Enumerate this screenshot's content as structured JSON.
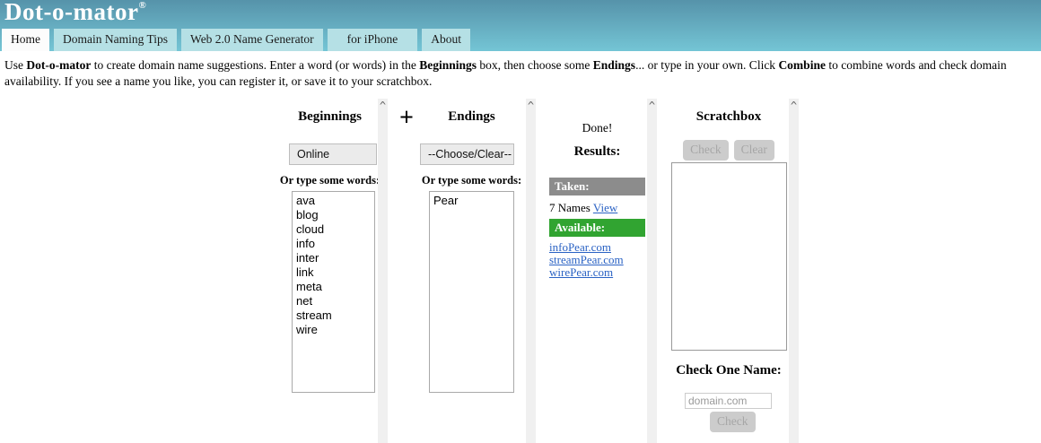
{
  "header": {
    "title": "Dot-o-mator",
    "registered_mark": "®",
    "tabs": [
      {
        "label": "Home",
        "active": true
      },
      {
        "label": "Domain Naming Tips",
        "active": false
      },
      {
        "label": "Web 2.0 Name Generator",
        "active": false
      },
      {
        "label": "for iPhone",
        "active": false
      },
      {
        "label": "About",
        "active": false
      }
    ]
  },
  "instructions": {
    "segments": [
      {
        "text": "Use ",
        "bold": false
      },
      {
        "text": "Dot-o-mator",
        "bold": true
      },
      {
        "text": " to create domain name suggestions. Enter a word (or words) in the ",
        "bold": false
      },
      {
        "text": "Beginnings",
        "bold": true
      },
      {
        "text": " box, then choose some ",
        "bold": false
      },
      {
        "text": "Endings",
        "bold": true
      },
      {
        "text": "... or type in your own. Click ",
        "bold": false
      },
      {
        "text": "Combine",
        "bold": true
      },
      {
        "text": " to combine words and check domain availability. If you see a name you like, you can register it, or save it to your scratchbox.",
        "bold": false
      }
    ]
  },
  "icons": {
    "scroll_up": "^"
  },
  "plus_sign": "+",
  "beginnings": {
    "heading": "Beginnings",
    "select_value": "Online",
    "label": "Or type some words:",
    "words": [
      "ava",
      "blog",
      "cloud",
      "info",
      "inter",
      "link",
      "meta",
      "net",
      "stream",
      "wire"
    ]
  },
  "endings": {
    "heading": "Endings",
    "select_value": "--Choose/Clear--",
    "label": "Or type some words:",
    "words": [
      "Pear"
    ]
  },
  "results": {
    "status": "Done!",
    "heading": "Results:",
    "taken": {
      "label": "Taken:",
      "count_text": "7 Names",
      "view_link": "View"
    },
    "available": {
      "label": "Available:",
      "domains": [
        "infoPear.com",
        "streamPear.com",
        "wirePear.com"
      ]
    }
  },
  "scratchbox": {
    "heading": "Scratchbox",
    "check_button": "Check",
    "clear_button": "Clear",
    "check_one_name": {
      "heading": "Check One Name:",
      "input_placeholder": "domain.com",
      "check_button": "Check"
    }
  },
  "colors": {
    "header_top": "#5693aa",
    "header_bottom": "#74c5d5",
    "tab_bg": "#b5e0e5",
    "tab_active_bg": "#fcfcfc",
    "taken_bar": "#8c8c8c",
    "available_bar": "#31a431",
    "link_blue": "#2a62c4",
    "btn_bg": "#cccccc",
    "btn_text": "#a6a6a6",
    "scrollbar_bg": "#f0f0f0"
  }
}
